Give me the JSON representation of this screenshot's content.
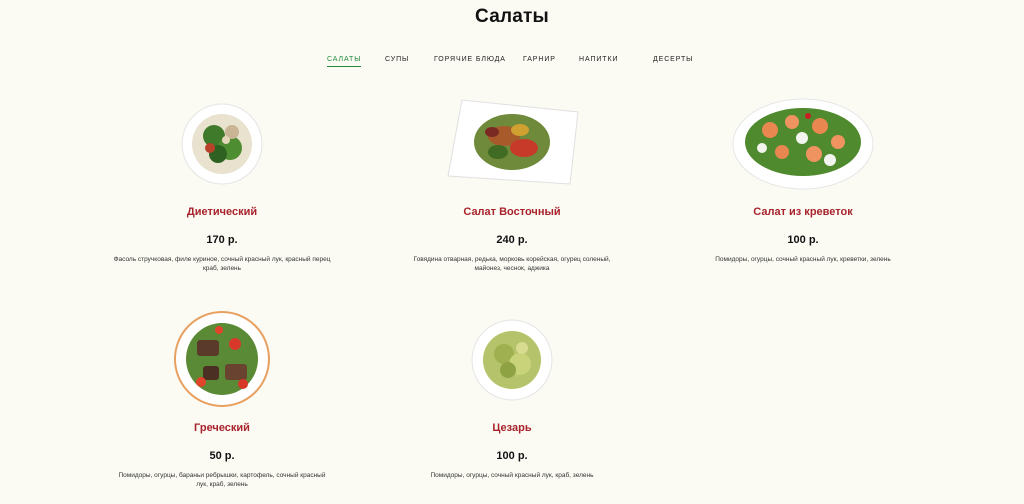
{
  "page": {
    "title": "Салаты"
  },
  "tabs": [
    {
      "label": "САЛАТЫ",
      "active": true
    },
    {
      "label": "СУПЫ",
      "active": false
    },
    {
      "label": "ГОРЯЧИЕ БЛЮДА",
      "active": false
    },
    {
      "label": "ГАРНИР",
      "active": false
    },
    {
      "label": "НАПИТКИ",
      "active": false
    },
    {
      "label": "ДЕСЕРТЫ",
      "active": false
    }
  ],
  "dishes": [
    {
      "name": "Диетический",
      "price": "170 р.",
      "description": "Фасоль стручковая, филе куриное, сочный красный лук, красный перец краб, зелень"
    },
    {
      "name": "Салат Восточный",
      "price": "240 р.",
      "description": "Говядина отварная, редька, морковь корейская, огурец соленый, майонез, чеснок, аджика"
    },
    {
      "name": "Салат из креветок",
      "price": "100 р.",
      "description": "Помидоры, огурцы, сочный красный лук, креветки, зелень"
    },
    {
      "name": "Греческий",
      "price": "50 р.",
      "description": "Помидоры, огурцы, бараньи ребрышки, картофель, сочный красный лук, краб, зелень"
    },
    {
      "name": "Цезарь",
      "price": "100 р.",
      "description": "Помидоры, огурцы, сочный красный лук, краб, зелень"
    }
  ],
  "colors": {
    "accent_green": "#1f8a3a",
    "dish_name_red": "#a8232c",
    "background": "#fbfbf4"
  }
}
